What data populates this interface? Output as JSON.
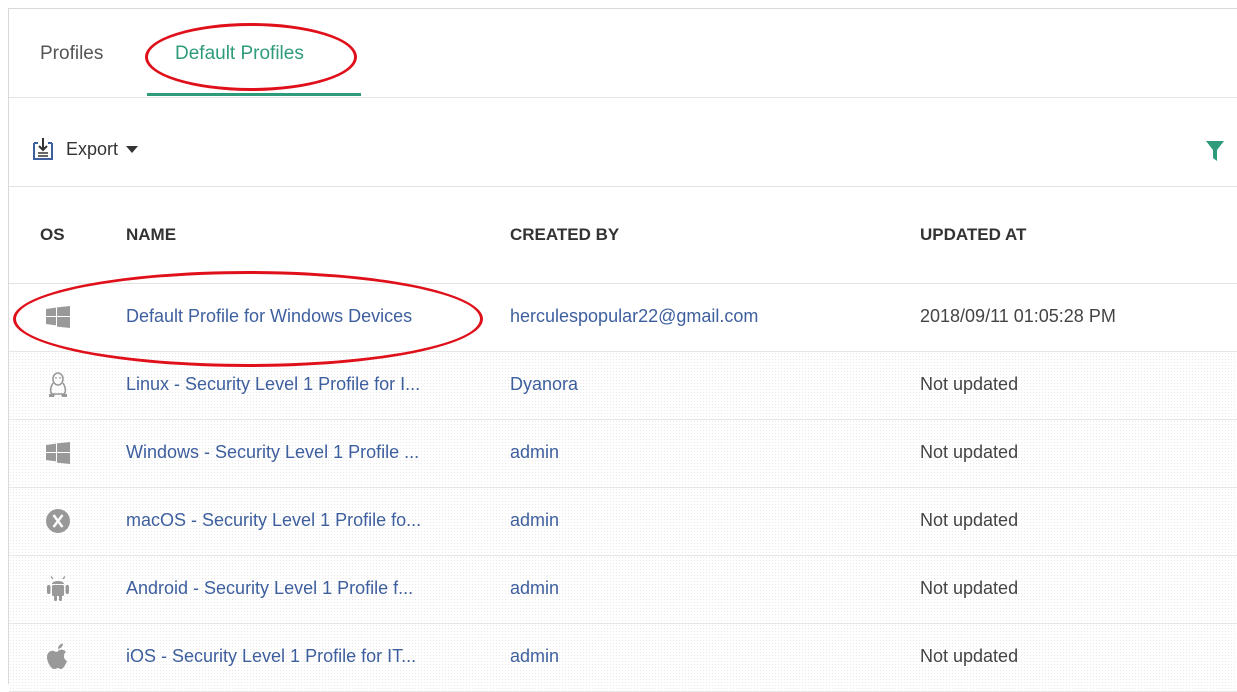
{
  "tabs": [
    {
      "label": "Profiles"
    },
    {
      "label": "Default Profiles"
    }
  ],
  "toolbar": {
    "export_label": "Export",
    "export_icon": "export-icon",
    "filter_icon": "filter-icon"
  },
  "table": {
    "headers": [
      "OS",
      "NAME",
      "CREATED BY",
      "UPDATED AT"
    ],
    "rows": [
      {
        "os": "windows-icon",
        "name": "Default Profile for Windows Devices",
        "created_by": "herculespopular22@gmail.com",
        "updated_at": "2018/09/11 01:05:28 PM"
      },
      {
        "os": "linux-icon",
        "name": "Linux - Security Level 1 Profile for I...",
        "created_by": "Dyanora",
        "updated_at": "Not updated"
      },
      {
        "os": "windows-icon",
        "name": "Windows - Security Level 1 Profile ...",
        "created_by": "admin",
        "updated_at": "Not updated"
      },
      {
        "os": "macos-icon",
        "name": "macOS - Security Level 1 Profile fo...",
        "created_by": "admin",
        "updated_at": "Not updated"
      },
      {
        "os": "android-icon",
        "name": "Android - Security Level 1 Profile f...",
        "created_by": "admin",
        "updated_at": "Not updated"
      },
      {
        "os": "apple-icon",
        "name": "iOS - Security Level 1 Profile for IT...",
        "created_by": "admin",
        "updated_at": "Not updated"
      }
    ]
  },
  "colors": {
    "accent": "#2e9b7a",
    "link": "#3e5f9e",
    "annotation": "#e0101a"
  }
}
